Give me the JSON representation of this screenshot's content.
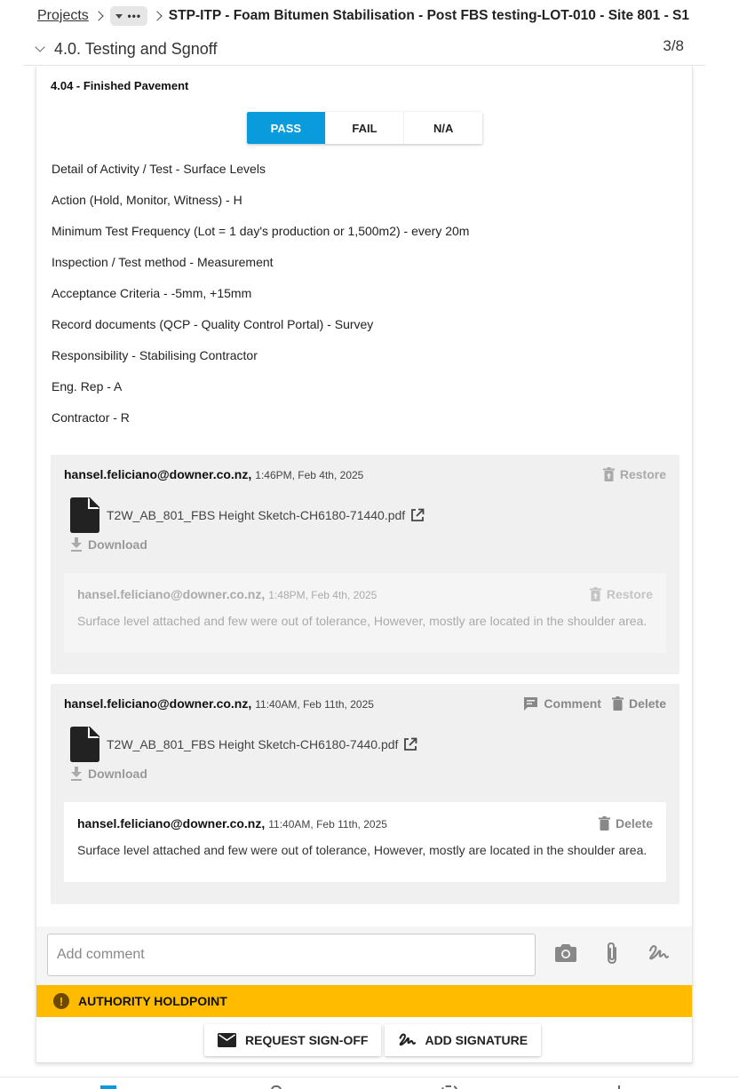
{
  "breadcrumb": {
    "root": "Projects",
    "current": "STP-ITP - Foam Bitumen Stabilisation - Post FBS testing-LOT-010 - Site 801 - S1"
  },
  "section": {
    "title": "4.0. Testing and Sgnoff",
    "count": "3/8"
  },
  "item": {
    "title": "4.04 - Finished Pavement",
    "status_options": [
      "PASS",
      "FAIL",
      "N/A"
    ],
    "selected_status": "PASS",
    "details": [
      "Detail of Activity / Test - Surface Levels",
      "Action (Hold, Monitor, Witness) - H",
      "Minimum Test Frequency (Lot = 1 day's production or 1,500m2) - every 20m",
      "Inspection / Test method - Measurement",
      "Acceptance Criteria - -5mm, +15mm",
      "Record documents (QCP - Quality Control Portal) - Survey",
      "Responsibility - Stabilising Contractor",
      "Eng. Rep - A",
      "Contractor - R"
    ]
  },
  "attachments": [
    {
      "author": "hansel.feliciano@downer.co.nz,",
      "time": "1:46PM, Feb 4th, 2025",
      "restore_label": "Restore",
      "file_name": "T2W_AB_801_FBS Height Sketch-CH6180-71440.pdf",
      "download_label": "Download",
      "reply": {
        "author": "hansel.feliciano@downer.co.nz,",
        "time": "1:48PM, Feb 4th, 2025",
        "restore_label": "Restore",
        "text": "Surface level attached and few were out of tolerance, However, mostly are located in the shoulder area."
      }
    },
    {
      "author": "hansel.feliciano@downer.co.nz,",
      "time": "11:40AM, Feb 11th, 2025",
      "comment_label": "Comment",
      "delete_label": "Delete",
      "file_name": "T2W_AB_801_FBS Height Sketch-CH6180-7440.pdf",
      "download_label": "Download",
      "reply": {
        "author": "hansel.feliciano@downer.co.nz,",
        "time": "11:40AM, Feb 11th, 2025",
        "delete_label": "Delete",
        "text": "Surface level attached and few were out of tolerance, However, mostly are located in the shoulder area."
      }
    }
  ],
  "comment_box": {
    "placeholder": "Add comment"
  },
  "holdpoint": {
    "label": "AUTHORITY HOLDPOINT",
    "icon": "!"
  },
  "buttons": {
    "request_signoff": "REQUEST SIGN-OFF",
    "add_signature": "ADD SIGNATURE"
  },
  "colors": {
    "accent": "#0a9bdc",
    "holdpoint_bg": "#ffbb00",
    "faded_text": "#aaaaaa",
    "icon_dark": "#222222"
  },
  "icons": {
    "camera": "camera-icon",
    "attach": "paperclip-icon",
    "signature": "signature-icon",
    "file": "file-icon",
    "external": "external-link-icon",
    "download": "download-icon",
    "trash": "trash-icon",
    "restore": "restore-icon",
    "comment": "comment-icon",
    "mail": "mail-icon"
  }
}
